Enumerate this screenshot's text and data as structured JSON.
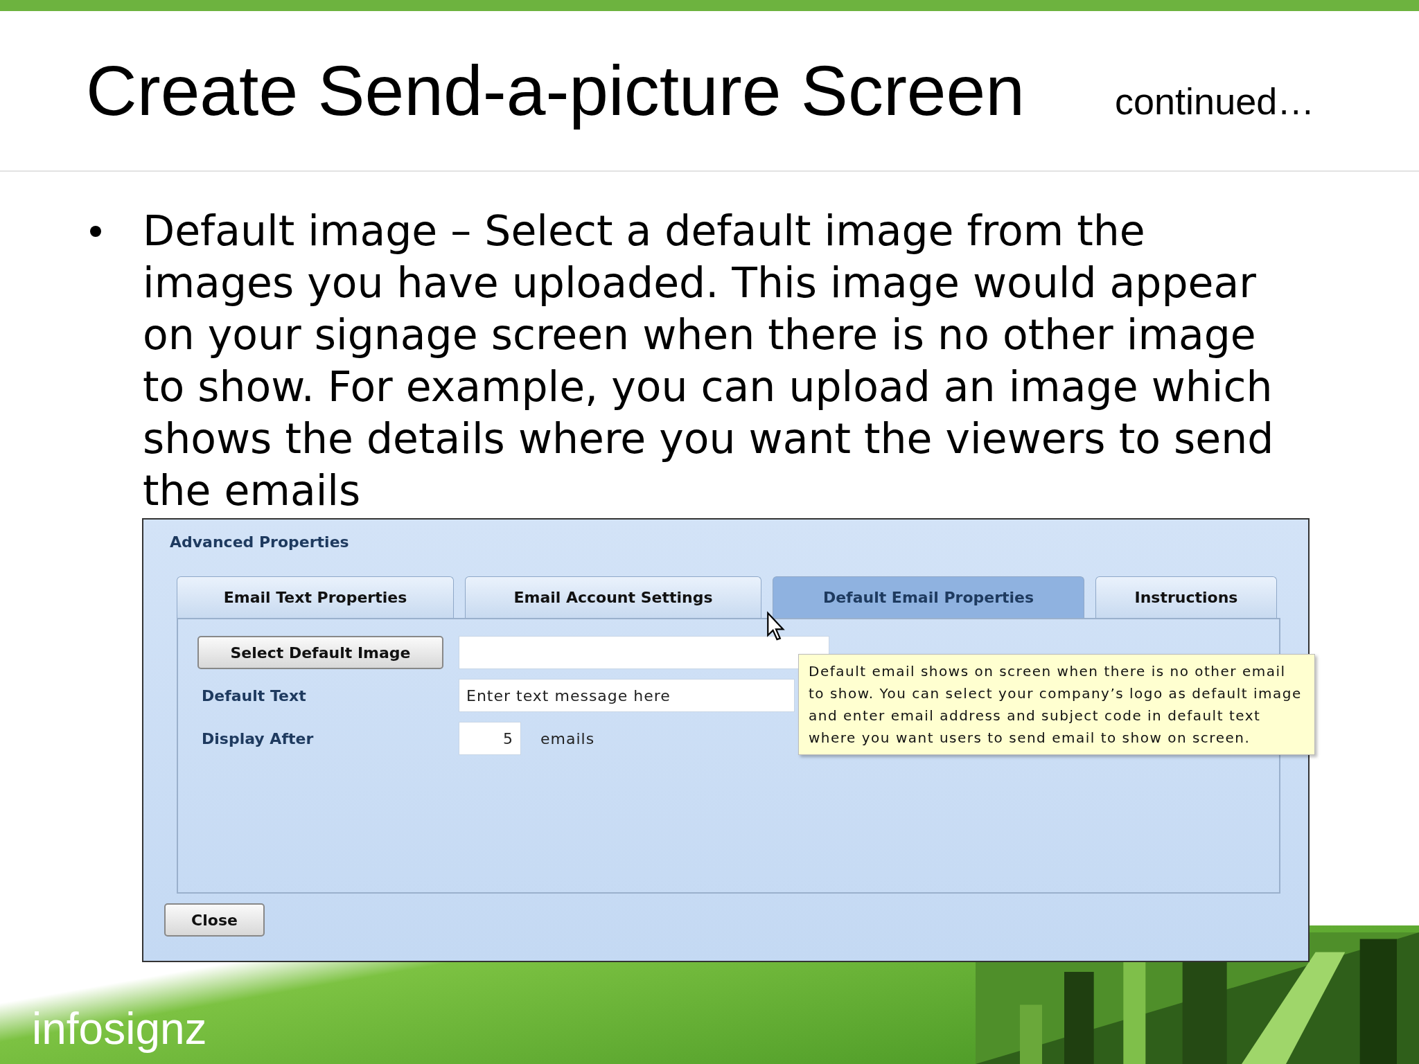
{
  "slide": {
    "title": "Create Send-a-picture Screen",
    "subtitle": "continued…",
    "bullets": [
      "Default image – Select a default image from the images you have uploaded. This image would appear on your signage screen when there is no other image to show. For example, you can upload an image which shows the details where you want the viewers to send the emails"
    ]
  },
  "dialog": {
    "title": "Advanced Properties",
    "tabs": [
      {
        "label": "Email Text Properties",
        "selected": false
      },
      {
        "label": "Email Account Settings",
        "selected": false
      },
      {
        "label": "Default Email Properties",
        "selected": true
      },
      {
        "label": "Instructions",
        "selected": false
      }
    ],
    "image_button": "Select Default Image",
    "default_text": {
      "label": "Default Text",
      "value": "Enter text message here"
    },
    "display_after": {
      "label": "Display After",
      "value": "5",
      "unit": "emails"
    },
    "tooltip": "Default email shows on screen when there is no other email to show. You can select your company’s logo as default image and enter email address and subject code in default text where you want users to send email to show on screen.",
    "close_button": "Close"
  },
  "footer": {
    "logo": "infosignz"
  }
}
